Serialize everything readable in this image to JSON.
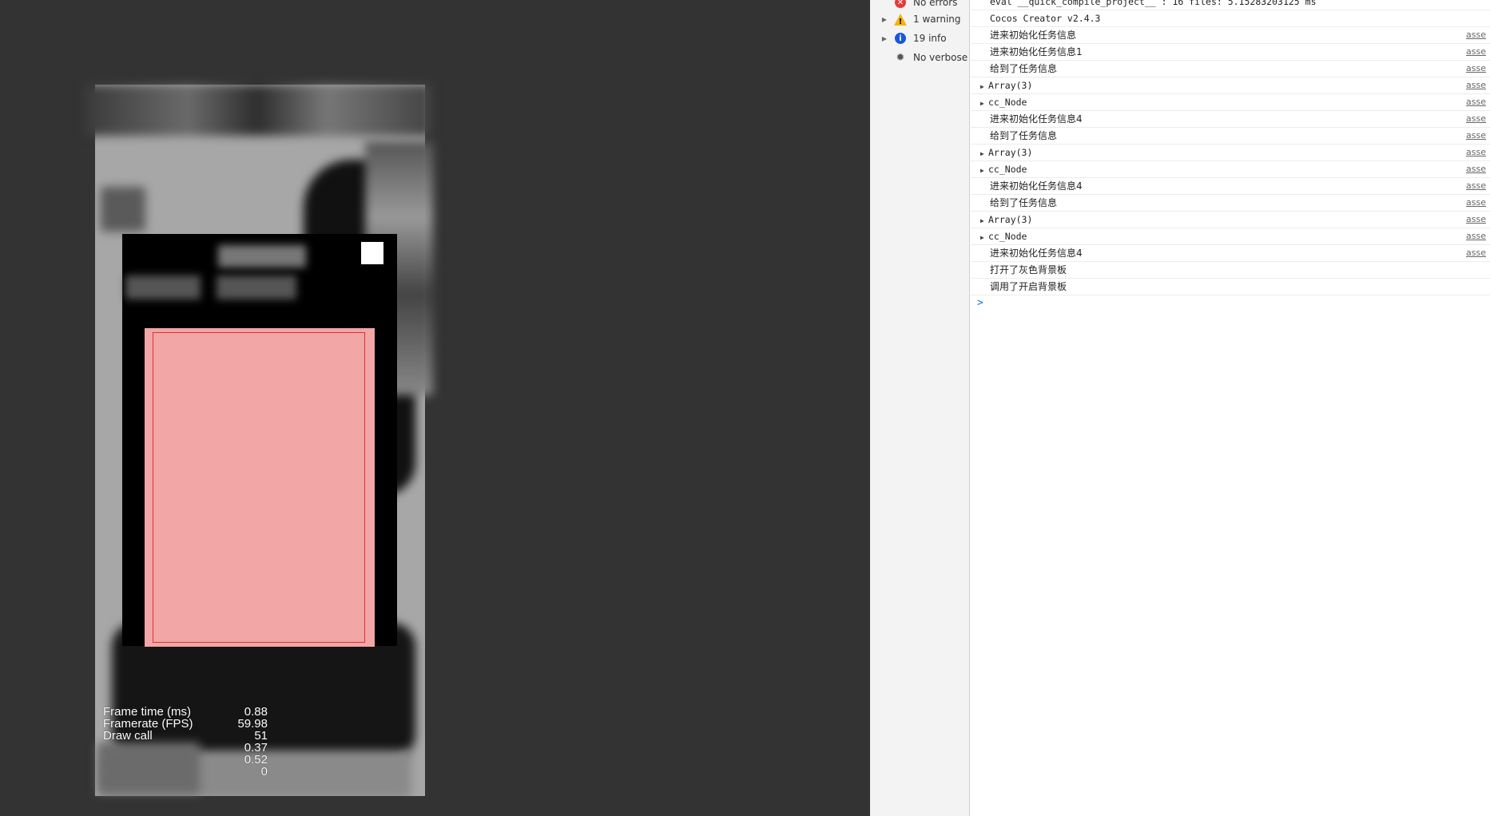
{
  "preview": {
    "stats": [
      {
        "label": "Frame time (ms)",
        "value": "0.88"
      },
      {
        "label": "Framerate (FPS)",
        "value": "59.98"
      },
      {
        "label": "Draw call",
        "value": "51"
      },
      {
        "label": "",
        "value": "0.37"
      },
      {
        "label": "",
        "value": "0.52"
      },
      {
        "label": "",
        "value": "0"
      }
    ],
    "colors": {
      "background": "#333333",
      "canvas": "#a7a7a7",
      "modal": "#000000",
      "card_fill": "#f2a6a6",
      "card_border": "#e03030"
    }
  },
  "devtools": {
    "filters": [
      {
        "label": "No errors",
        "icon": "error-icon",
        "color": "#e53935",
        "expandable": false
      },
      {
        "label": "1 warning",
        "icon": "warning-icon",
        "color": "#f4b400",
        "expandable": true
      },
      {
        "label": "19 info",
        "icon": "info-icon",
        "color": "#1a56db",
        "expandable": true
      },
      {
        "label": "No verbose",
        "icon": "bug-icon",
        "color": "#555555",
        "expandable": false
      }
    ],
    "logs": [
      {
        "text": "eval __quick_compile_project__ : 16 files: 5.15283203125 ms",
        "source": "",
        "expandable": false,
        "zh": false
      },
      {
        "text": "Cocos Creator v2.4.3",
        "source": "",
        "expandable": false,
        "zh": false
      },
      {
        "text": "进来初始化任务信息",
        "source": "asse",
        "expandable": false,
        "zh": true
      },
      {
        "text": "进来初始化任务信息1",
        "source": "asse",
        "expandable": false,
        "zh": true
      },
      {
        "text": "给到了任务信息",
        "source": "asse",
        "expandable": false,
        "zh": true
      },
      {
        "text": "Array(3)",
        "source": "asse",
        "expandable": true,
        "zh": false
      },
      {
        "text": "cc_Node",
        "source": "asse",
        "expandable": true,
        "zh": false
      },
      {
        "text": "进来初始化任务信息4",
        "source": "asse",
        "expandable": false,
        "zh": true
      },
      {
        "text": "给到了任务信息",
        "source": "asse",
        "expandable": false,
        "zh": true
      },
      {
        "text": "Array(3)",
        "source": "asse",
        "expandable": true,
        "zh": false
      },
      {
        "text": "cc_Node",
        "source": "asse",
        "expandable": true,
        "zh": false
      },
      {
        "text": "进来初始化任务信息4",
        "source": "asse",
        "expandable": false,
        "zh": true
      },
      {
        "text": "给到了任务信息",
        "source": "asse",
        "expandable": false,
        "zh": true
      },
      {
        "text": "Array(3)",
        "source": "asse",
        "expandable": true,
        "zh": false
      },
      {
        "text": "cc_Node",
        "source": "asse",
        "expandable": true,
        "zh": false
      },
      {
        "text": "进来初始化任务信息4",
        "source": "asse",
        "expandable": false,
        "zh": true
      },
      {
        "text": "打开了灰色背景板",
        "source": "",
        "expandable": false,
        "zh": true
      },
      {
        "text": "调用了开启背景板",
        "source": "",
        "expandable": false,
        "zh": true
      }
    ],
    "prompt_symbol": ">"
  }
}
